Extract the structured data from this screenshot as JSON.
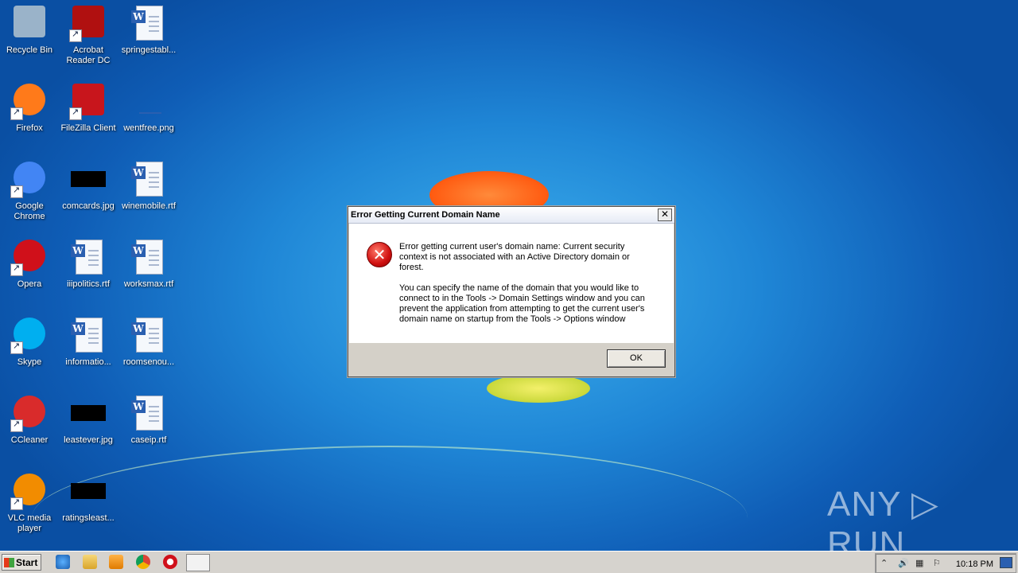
{
  "desktop_icons": [
    {
      "label": "Recycle Bin",
      "icon": "recycle-bin-icon"
    },
    {
      "label": "Acrobat\nReader DC",
      "icon": "acrobat-icon"
    },
    {
      "label": "springestabl...",
      "icon": "word-doc-icon"
    },
    {
      "label": "Firefox",
      "icon": "firefox-icon"
    },
    {
      "label": "FileZilla Client",
      "icon": "filezilla-icon"
    },
    {
      "label": "wentfree.png",
      "icon": "image-file-icon"
    },
    {
      "label": "Google\nChrome",
      "icon": "chrome-icon"
    },
    {
      "label": "comcards.jpg",
      "icon": "image-file-icon"
    },
    {
      "label": "winemobile.rtf",
      "icon": "word-doc-icon"
    },
    {
      "label": "Opera",
      "icon": "opera-icon"
    },
    {
      "label": "iiipolitics.rtf",
      "icon": "word-doc-icon"
    },
    {
      "label": "worksmax.rtf",
      "icon": "word-doc-icon"
    },
    {
      "label": "Skype",
      "icon": "skype-icon"
    },
    {
      "label": "informatio...",
      "icon": "word-doc-icon"
    },
    {
      "label": "roomsenou...",
      "icon": "word-doc-icon"
    },
    {
      "label": "CCleaner",
      "icon": "ccleaner-icon"
    },
    {
      "label": "leastever.jpg",
      "icon": "image-file-icon"
    },
    {
      "label": "caseip.rtf",
      "icon": "word-doc-icon"
    },
    {
      "label": "VLC media\nplayer",
      "icon": "vlc-icon"
    },
    {
      "label": "ratingsleast...",
      "icon": "image-file-icon"
    }
  ],
  "dialog": {
    "title": "Error Getting Current Domain Name",
    "message_1": "Error getting current user's domain name: Current security context is not associated with an Active Directory domain or forest.",
    "message_2": "You can specify the name of the domain that you would like to connect to in the Tools -> Domain Settings window and you can prevent the application from attempting to get the current user's domain name on startup from the Tools -> Options window",
    "ok_label": "OK",
    "close_label": "✕"
  },
  "taskbar": {
    "start_label": "Start",
    "pinned": [
      "internet-explorer-icon",
      "explorer-folder-icon",
      "media-player-icon",
      "chrome-icon",
      "opera-icon",
      "app-window-icon"
    ],
    "clock": "10:18 PM"
  },
  "watermark": "ANY ▷ RUN",
  "colors": {
    "desktop_blue": "#1f86d6",
    "taskbar": "#d6d3ce",
    "error_red": "#d01010"
  }
}
